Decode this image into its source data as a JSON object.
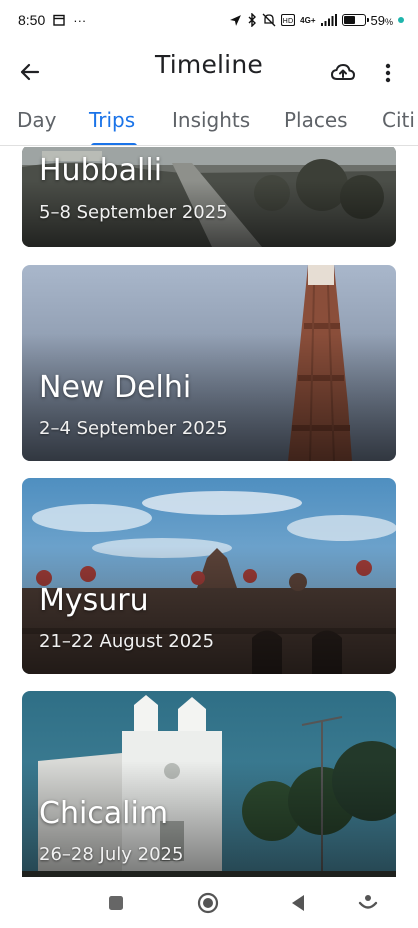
{
  "status_bar": {
    "time": "8:50",
    "network": "4G+",
    "battery_percent": "59",
    "battery_symbol": "%",
    "battery_level": 0.59,
    "icons": [
      "calendar-icon",
      "more-dots-icon",
      "location-icon",
      "bluetooth-icon",
      "mute-icon",
      "volte-icon",
      "signal-icon",
      "battery-icon"
    ]
  },
  "app_bar": {
    "title": "Timeline",
    "back_icon": "arrow-back-icon",
    "upload_icon": "cloud-upload-icon",
    "more_icon": "more-vert-icon"
  },
  "tabs": [
    {
      "label": "Day",
      "active": false
    },
    {
      "label": "Trips",
      "active": true
    },
    {
      "label": "Insights",
      "active": false
    },
    {
      "label": "Places",
      "active": false
    },
    {
      "label": "Citi",
      "active": false
    }
  ],
  "trips": [
    {
      "city": "Hubballi",
      "dates": "5–8 September 2025"
    },
    {
      "city": "New Delhi",
      "dates": "2–4 September 2025"
    },
    {
      "city": "Mysuru",
      "dates": "21–22 August 2025"
    },
    {
      "city": "Chicalim",
      "dates": "26–28 July 2025"
    }
  ],
  "nav_bar": {
    "items": [
      "square-recents-icon",
      "circle-home-icon",
      "triangle-back-icon",
      "assistant-icon"
    ]
  },
  "colors": {
    "accent": "#1a73e8",
    "tab_inactive": "#5f6368",
    "title": "#202124"
  }
}
